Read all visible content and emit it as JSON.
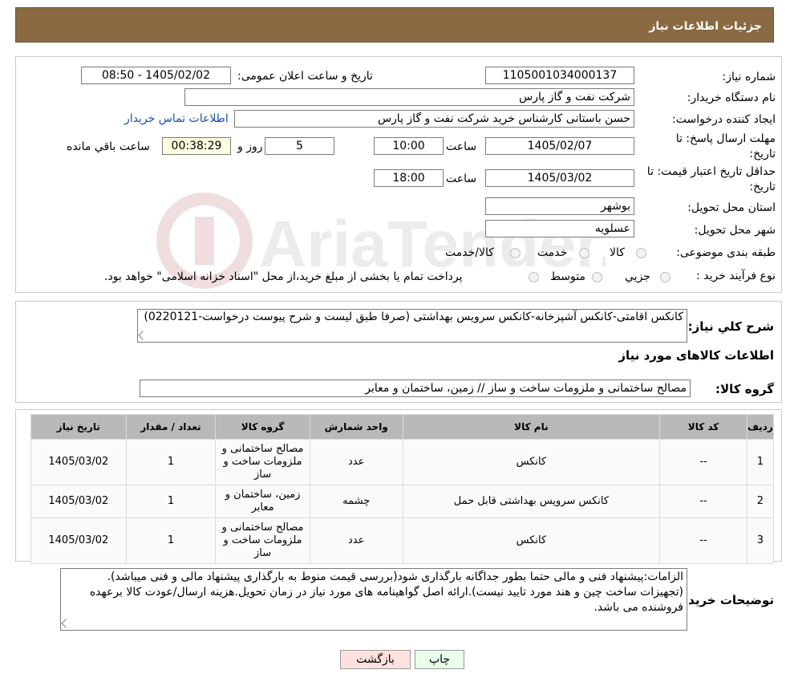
{
  "header": {
    "title": "جزئیات اطلاعات نیاز"
  },
  "form": {
    "need_number_label": "شماره نیاز:",
    "need_number": "1105001034000137",
    "announce_label": "تاریخ و ساعت اعلان عمومی:",
    "announce_value": "1405/02/02 - 08:50",
    "buyer_org_label": "نام دستگاه خریدار:",
    "buyer_org": "شرکت نفت و گاز پارس",
    "creator_label": "ایجاد کننده درخواست:",
    "creator": "حسن باستانی کارشناس خرید شرکت نفت و گاز پارس",
    "contact_link": "اطلاعات تماس خریدار",
    "deadline_label_1": "مهلت ارسال پاسخ: تا",
    "deadline_label_2": "تاریخ:",
    "deadline_date": "1405/02/07",
    "time_label": "ساعت",
    "deadline_time": "10:00",
    "days_value": "5",
    "days_label": "روز و",
    "remaining_time": "00:38:29",
    "remaining_label": "ساعت باقي مانده",
    "validity_label_1": "حداقل تاریخ اعتبار قیمت: تا",
    "validity_label_2": "تاریخ:",
    "validity_date": "1405/03/02",
    "validity_time_label": "ساعت",
    "validity_time": "18:00",
    "province_label": "استان محل تحویل:",
    "province": "بوشهر",
    "city_label": "شهر محل تحویل:",
    "city": "عسلویه",
    "category_label": "طبقه بندی موضوعی:",
    "category_options": [
      "کالا",
      "خدمت",
      "کالا/خدمت"
    ],
    "process_label": "نوع فرآیند خرید :",
    "process_options": [
      "جزیي",
      "متوسط"
    ],
    "process_note": "پرداخت تمام یا بخشی از مبلغ خرید،از محل \"اسناد خزانه اسلامی\" خواهد بود."
  },
  "description": {
    "label": "شرح کلي نياز:",
    "text": "کانکس اقامتی-کانکس آشپزخانه-کانکس سرویس بهداشتی (صرفا طبق لیست و شرح پیوست درخواست-0220121)",
    "goods_info_title": "اطلاعات کالاهای مورد نیاز",
    "goods_group_label": "گروه کالا:",
    "goods_group": "مصالح ساختمانی و ملزومات ساخت و ساز // زمین، ساختمان و معابر"
  },
  "table": {
    "headers": [
      "ردیف",
      "کد کالا",
      "نام کالا",
      "واحد شمارش",
      "گروه کالا",
      "تعداد / مقدار",
      "تاریخ نیاز"
    ],
    "rows": [
      {
        "row": "1",
        "code": "--",
        "name": "کانکس",
        "unit": "عدد",
        "group": "مصالح ساختمانی و ملزومات ساخت و ساز",
        "qty": "1",
        "date": "1405/03/02"
      },
      {
        "row": "2",
        "code": "--",
        "name": "کانکس سرویس بهداشتی قابل حمل",
        "unit": "چشمه",
        "group": "زمین، ساختمان و معابر",
        "qty": "1",
        "date": "1405/03/02"
      },
      {
        "row": "3",
        "code": "--",
        "name": "کانکس",
        "unit": "عدد",
        "group": "مصالح ساختمانی و ملزومات ساخت و ساز",
        "qty": "1",
        "date": "1405/03/02"
      }
    ]
  },
  "buyer_notes": {
    "label": "توضیحات خریدار:",
    "text": "الزامات:پیشنهاد فنی و مالی حتما  بطور جداگانه بارگذاری شود(بررسی قیمت منوط به بارگذاری پیشنهاد مالی و فنی میباشد).(تجهیزات ساخت چین و هند مورد تایید نیست).ارائه اصل گواهینامه های مورد نیاز در زمان تحویل.هزینه ارسال/عودت کالا برعهده فروشنده می باشد."
  },
  "buttons": {
    "print": "چاپ",
    "back": "بازگشت"
  },
  "watermark": "AriaTender.neT",
  "colors": {
    "header_bg": "#8a6a42",
    "link": "#1a4fb0",
    "print_bg": "#eaffea",
    "back_bg": "#ffe0e0",
    "remaining_bg": "#fffde0"
  }
}
